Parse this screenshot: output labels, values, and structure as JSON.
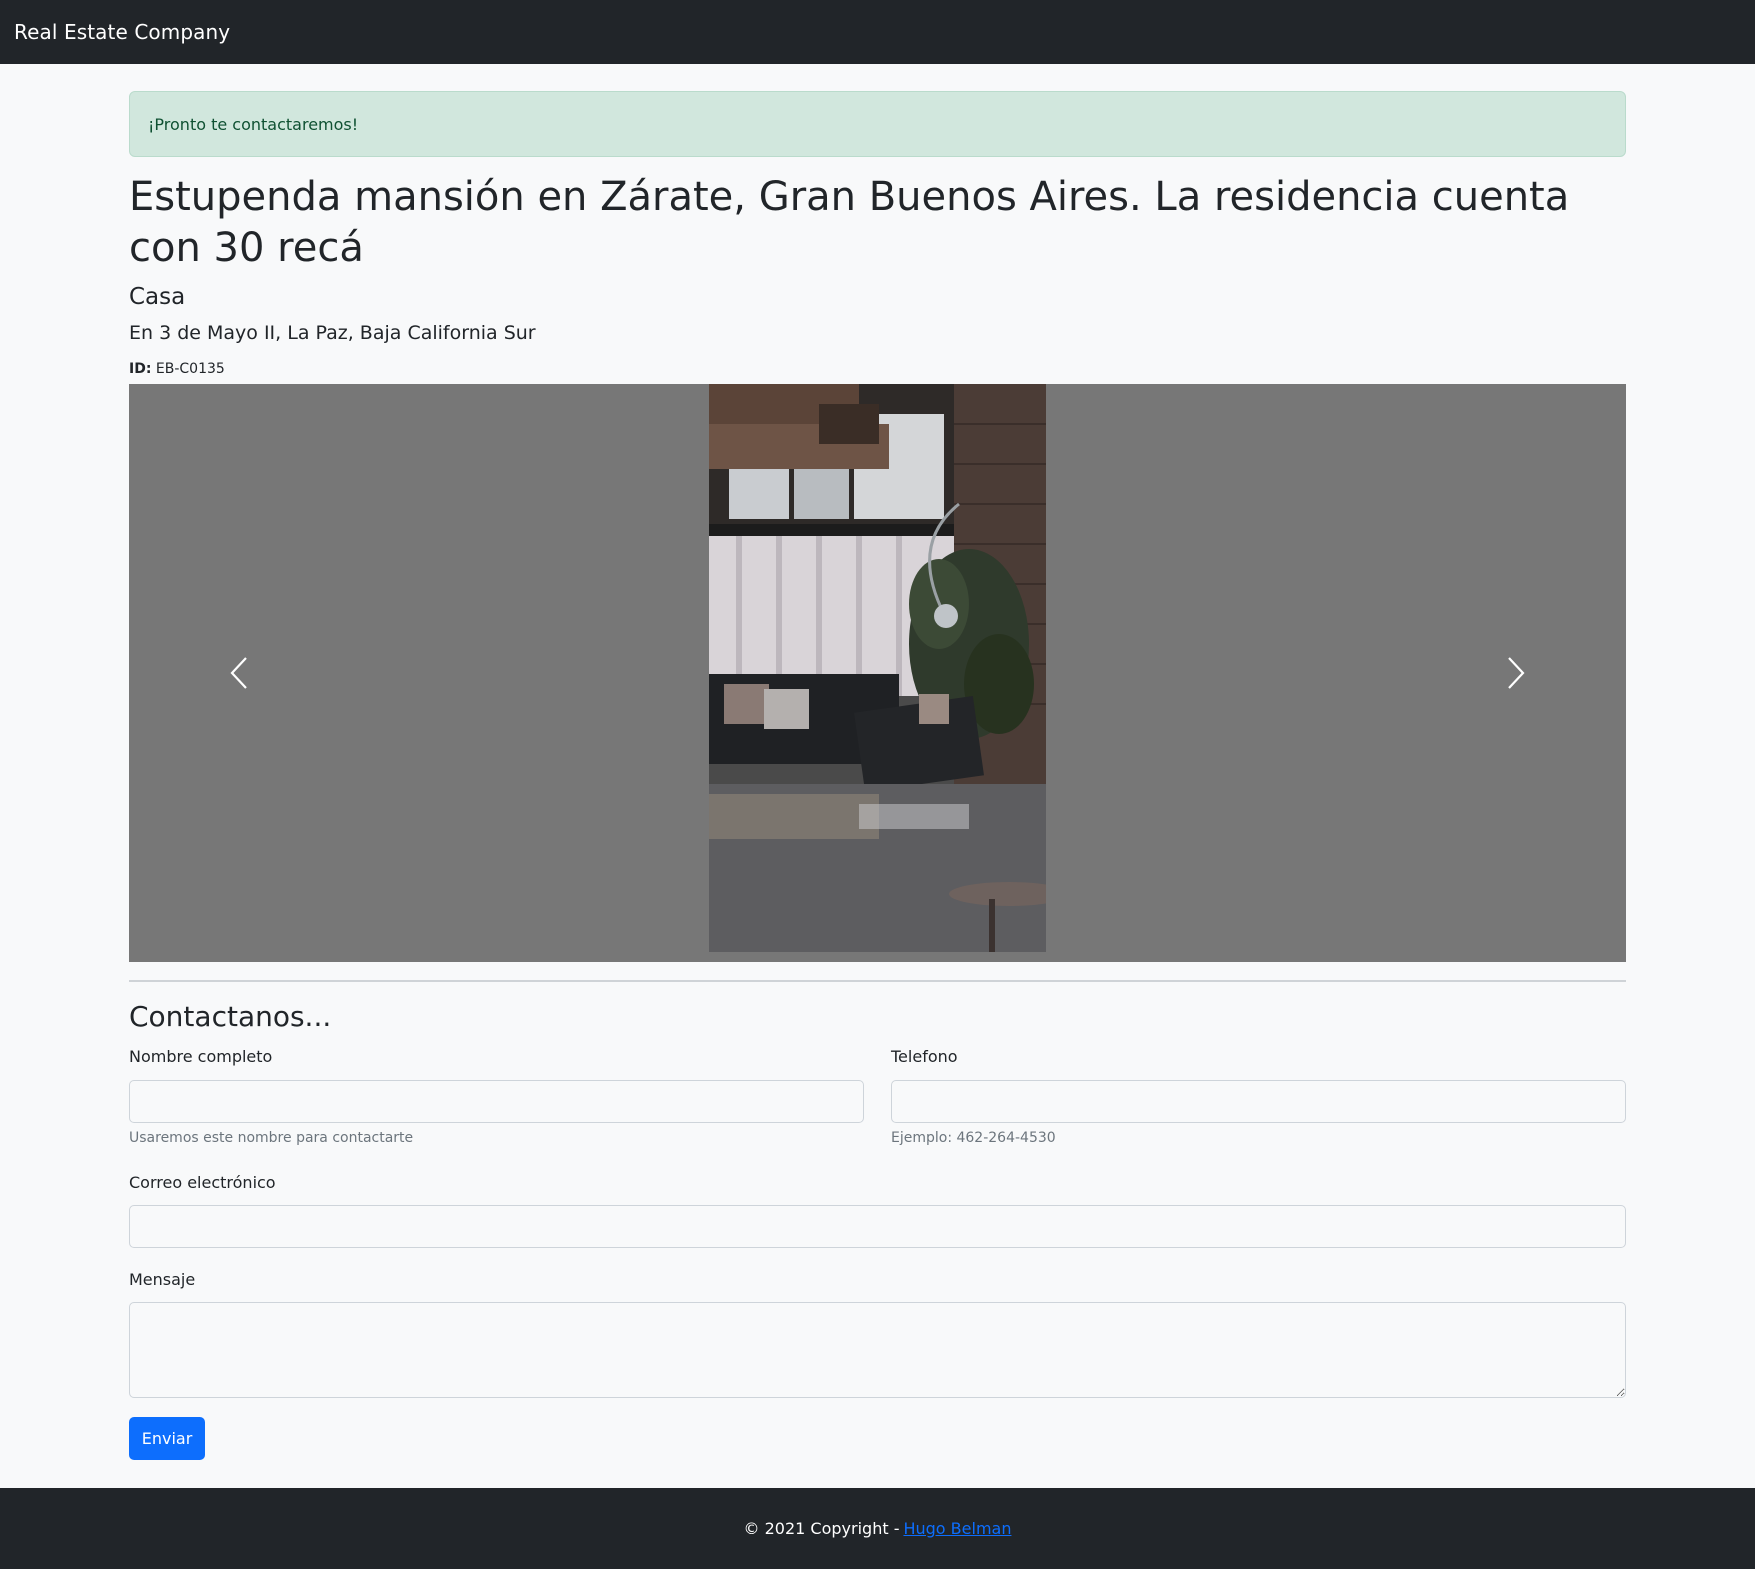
{
  "navbar": {
    "brand": "Real Estate Company"
  },
  "alert": {
    "message": "¡Pronto te contactaremos!"
  },
  "property": {
    "title": "Estupenda mansión en Zárate, Gran Buenos Aires. La residencia cuenta con 30 recá",
    "type": "Casa",
    "location": "En 3 de Mayo II, La Paz, Baja California Sur",
    "id_label": "ID:",
    "id_value": "EB-C0135"
  },
  "carousel": {
    "prev_icon": "chevron-left-icon",
    "next_icon": "chevron-right-icon",
    "background": "#777777"
  },
  "contact": {
    "heading": "Contactanos...",
    "name_label": "Nombre completo",
    "name_value": "",
    "name_help": "Usaremos este nombre para contactarte",
    "phone_label": "Telefono",
    "phone_value": "",
    "phone_help": "Ejemplo: 462-264-4530",
    "email_label": "Correo electrónico",
    "email_value": "",
    "message_label": "Mensaje",
    "message_value": "",
    "submit_label": "Enviar"
  },
  "footer": {
    "copyright": "© 2021 Copyright -",
    "author_link": "Hugo Belman"
  },
  "colors": {
    "primary": "#0d6efd",
    "dark": "#212529",
    "alert_bg": "#d1e7dd",
    "alert_text": "#0f5132"
  }
}
